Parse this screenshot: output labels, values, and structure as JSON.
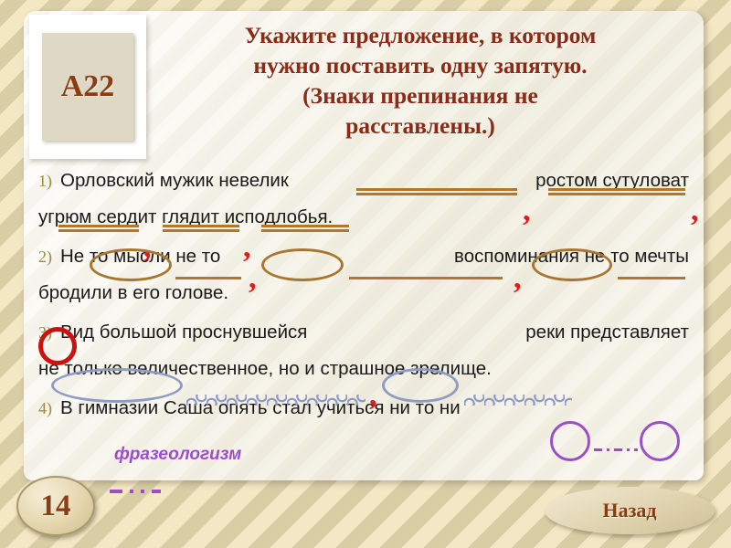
{
  "slide": {
    "code_label": "A22",
    "page_number": "14",
    "title_lines": [
      "Укажите предложение, в котором",
      "нужно поставить одну запятую.",
      "(Знаки препинания не",
      "расставлены.)"
    ],
    "annotation": "фразеологизм",
    "back_button_label": "Назад",
    "answer_marked": "3"
  },
  "options": [
    {
      "number": "1)",
      "line1_left": "Орловский   мужик   невелик",
      "line1_right": "ростом    сутуловат",
      "line2": "угрюм  сердит  глядит исподлобья."
    },
    {
      "number": "2)",
      "line1_left": "Не  то  мысли  не  то",
      "line1_right": "воспоминания    не  то  мечты",
      "line2": "бродили в его голове."
    },
    {
      "number": "3)",
      "line1_left": "Вид  большой  проснувшейся",
      "line1_right": "реки  представляет",
      "line2": "не только величественное, но и страшное зрелище."
    },
    {
      "number": "4)",
      "line1_left": "В гимназии Саша опять стал учиться ни то ни",
      "line1_right": "",
      "line2": ""
    }
  ],
  "colors": {
    "title": "#8b2b16",
    "code": "#8a3c12",
    "number": "#a08a3d",
    "comma_red": "#e01b1b",
    "mark_brown": "#b3762c",
    "oval_brown": "#a9752f",
    "oval_blue": "#8e9bc4",
    "purple": "#9a4fc9",
    "answer_red": "#cc1111"
  }
}
